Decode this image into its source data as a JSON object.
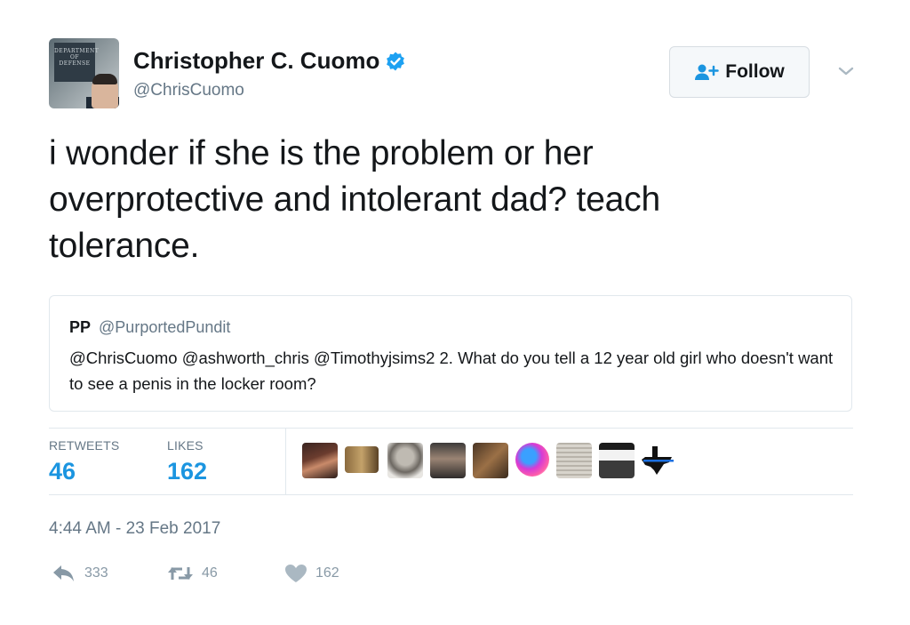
{
  "author": {
    "name": "Christopher C. Cuomo",
    "handle": "@ChrisCuomo",
    "verified_icon": "verified-badge-icon",
    "avatar_sign": "DEPARTMENT OF DEFENSE"
  },
  "follow_button": {
    "label": "Follow",
    "icon": "add-user-icon"
  },
  "tweet": {
    "text": "i wonder if she is the problem or her overprotective and intolerant dad? teach tolerance."
  },
  "quoted_tweet": {
    "name": "PP",
    "handle": "@PurportedPundit",
    "text": "@ChrisCuomo @ashworth_chris @Timothyjsims2 2. What do you tell a 12 year old girl who doesn't want to see a penis in the locker room?"
  },
  "stats": {
    "retweets_label": "RETWEETS",
    "retweets": "46",
    "likes_label": "LIKES",
    "likes": "162"
  },
  "likers": [
    {
      "name": "liker-avatar-1"
    },
    {
      "name": "liker-avatar-2"
    },
    {
      "name": "liker-avatar-3"
    },
    {
      "name": "liker-avatar-4"
    },
    {
      "name": "liker-avatar-5"
    },
    {
      "name": "liker-avatar-6"
    },
    {
      "name": "liker-avatar-7"
    },
    {
      "name": "liker-avatar-8"
    },
    {
      "name": "liker-avatar-9"
    }
  ],
  "timestamp": "4:44 AM - 23 Feb 2017",
  "actions": {
    "reply_count": "333",
    "retweet_count": "46",
    "like_count": "162"
  },
  "colors": {
    "accent": "#1b95e0",
    "text": "#14171a",
    "muted": "#657786",
    "border": "#e1e8ed"
  }
}
